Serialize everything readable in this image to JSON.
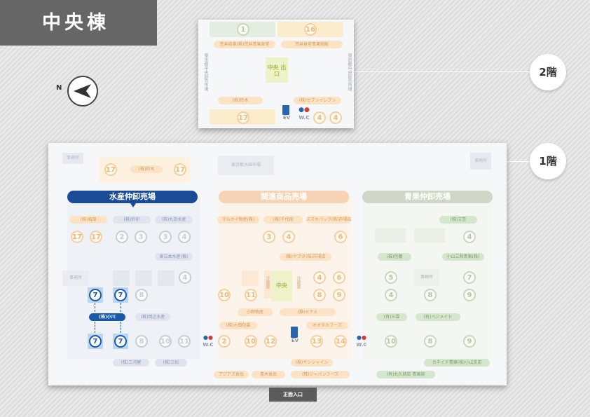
{
  "building_title": "中央棟",
  "compass": {
    "label": "N"
  },
  "floors": {
    "floor2": "2階",
    "floor1": "1階"
  },
  "entrance": "正面入口",
  "floor2": {
    "labels": {
      "wc": "W.C",
      "ev": "EV",
      "stair": "中央 出口",
      "left_vertical": "東京都中央卸売市場",
      "right_vertical": "東京都中央卸売市場"
    },
    "tenants": [
      "荒井商事(株)荒井青果食堂",
      "荒井食堂青果物販",
      "(株)鈴木",
      "(株)セブンイレブン"
    ],
    "stall_numbers": [
      "1",
      "16",
      "17",
      "4",
      "4"
    ]
  },
  "floor1": {
    "sections": {
      "seafood": "水産仲卸売場",
      "related": "関連商品売場",
      "produce": "青果仲卸売場"
    },
    "top_labels": {
      "a": "事務所",
      "b": "事務所",
      "center": "東京都大田市場",
      "tenant": "(株)鈴木"
    },
    "labels": {
      "wc": "W.C",
      "ev": "EV",
      "center": "中央",
      "vert_left": "冷蔵庫",
      "vert_right": "冷蔵庫",
      "office": "事務所",
      "office2": "事務所"
    },
    "seafood_tenants": [
      "(株)高田",
      "(株)鈴印",
      "(株)丸京水産",
      "東日本水産(株)",
      "(株)小川",
      "(株)岡辺水産",
      "(株)三河屋",
      "(株)三松"
    ],
    "related_tenants": [
      "マルカイ物産(株)",
      "(株)千代田",
      "スズキパック(株)市場店",
      "(株)ヤブタ(株)市場店",
      "小野物産",
      "(株)ミナミ",
      "(株)大田包装",
      "(株)鈴木",
      "オオタカフーズ",
      "アジアズ食品",
      "青木食品",
      "(株)サンシャイン",
      "(株)ジャパンフーズ"
    ],
    "produce_tenants": [
      "(株)三笠",
      "(株)信農",
      "小山三和青果(株)",
      "(有)三雲",
      "(有)ベジメイト",
      "カネイチ青果(株)小山支店",
      "(有)丸久商店 青果部"
    ],
    "stall_numbers": {
      "top": [
        "17",
        "17"
      ],
      "seafood": [
        "17",
        "17",
        "2",
        "3",
        "3",
        "4",
        "4",
        "7",
        "7",
        "8",
        "7",
        "7",
        "8",
        "10",
        "11"
      ],
      "related": [
        "3",
        "4",
        "6",
        "4",
        "6",
        "10",
        "11",
        "8",
        "9",
        "2",
        "10",
        "12",
        "13",
        "14"
      ],
      "produce": [
        "4",
        "5",
        "8",
        "7",
        "4",
        "8",
        "9",
        "10",
        "8",
        "9"
      ]
    }
  },
  "colors": {
    "seafood": "#1a4b96",
    "related": "#f6d3b4",
    "produce": "#cfd8c6",
    "highlight": "#1a5aa6"
  }
}
